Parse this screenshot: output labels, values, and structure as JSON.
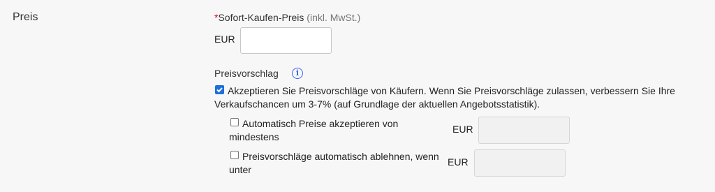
{
  "section": {
    "label": "Preis"
  },
  "buy_now": {
    "required_marker": "*",
    "label": "Sofort-Kaufen-Preis",
    "sublabel": "(inkl. MwSt.)",
    "currency": "EUR",
    "value": ""
  },
  "best_offer": {
    "title": "Preisvorschlag",
    "info_icon": "info-icon",
    "accept": {
      "checked": true,
      "text": "Akzeptieren Sie Preisvorschläge von Käufern. Wenn Sie Preisvorschläge zulassen, verbessern Sie Ihre Verkaufschancen um 3-7% (auf Grundlage der aktuellen Angebotsstatistik)."
    },
    "auto_accept": {
      "checked": false,
      "text": "Automatisch Preise akzeptieren von mindestens",
      "currency": "EUR",
      "value": ""
    },
    "auto_decline": {
      "checked": false,
      "text": "Preisvorschläge automatisch ablehnen, wenn unter",
      "currency": "EUR",
      "value": ""
    }
  },
  "colors": {
    "accent": "#3665f3",
    "checkbox": "#1e6fd9",
    "required": "#d0021b"
  }
}
